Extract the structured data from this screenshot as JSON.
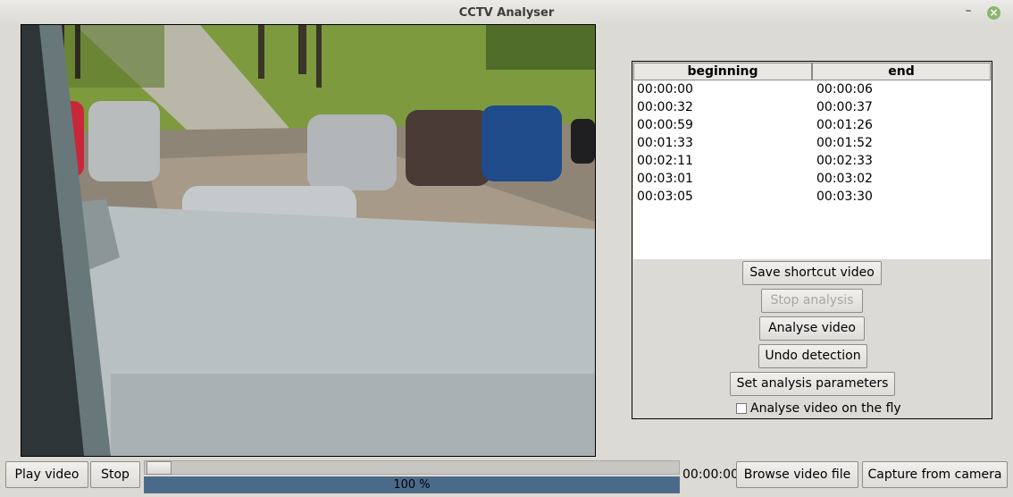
{
  "window": {
    "title": "CCTV Analyser",
    "minimize_glyph": "–",
    "close_glyph": "×"
  },
  "video": {
    "description_icon": "cctv-frame-icon"
  },
  "table": {
    "headers": [
      "beginning",
      "end"
    ],
    "rows": [
      [
        "00:00:00",
        "00:00:06"
      ],
      [
        "00:00:32",
        "00:00:37"
      ],
      [
        "00:00:59",
        "00:01:26"
      ],
      [
        "00:01:33",
        "00:01:52"
      ],
      [
        "00:02:11",
        "00:02:33"
      ],
      [
        "00:03:01",
        "00:03:02"
      ],
      [
        "00:03:05",
        "00:03:30"
      ]
    ]
  },
  "actions": {
    "save_shortcut": "Save shortcut video",
    "stop_analysis": "Stop analysis",
    "analyse_video": "Analyse video",
    "undo_detection": "Undo detection",
    "set_parameters": "Set analysis parameters",
    "analyse_on_fly": "Analyse video on the fly",
    "analyse_on_fly_checked": false,
    "stop_analysis_enabled": false
  },
  "controls": {
    "play_video": "Play video",
    "stop": "Stop",
    "position_fraction": 0.0,
    "progress_fraction": 1.0,
    "progress_text": "100 %",
    "time": "00:00:00",
    "browse": "Browse video file",
    "capture": "Capture from camera"
  },
  "colors": {
    "progress_fill": "#4a6a8c",
    "close_button": "#8bb46f"
  }
}
